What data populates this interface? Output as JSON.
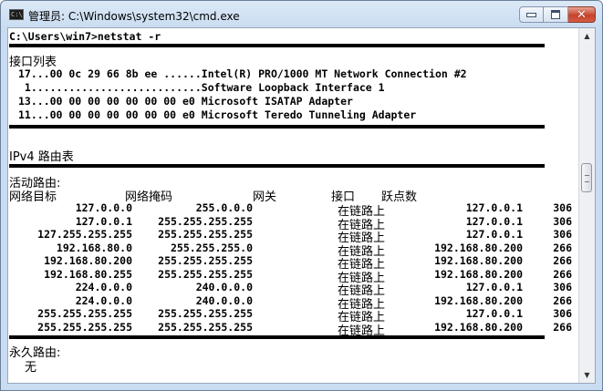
{
  "window": {
    "title": "管理员: C:\\Windows\\system32\\cmd.exe",
    "icon_text": "C:\\",
    "controls": [
      "minimize-icon",
      "maximize-icon",
      "close-icon"
    ]
  },
  "console": {
    "prompt": "C:\\Users\\win7>netstat -r",
    "interface_list_header": "接口列表",
    "interfaces": [
      "17...00 0c 29 66 8b ee ......Intel(R) PRO/1000 MT Network Connection #2",
      " 1...........................Software Loopback Interface 1",
      "13...00 00 00 00 00 00 00 e0 Microsoft ISATAP Adapter",
      "11...00 00 00 00 00 00 00 e0 Microsoft Teredo Tunneling Adapter"
    ],
    "ipv4_title": "IPv4 路由表",
    "active_routes_label": "活动路由:",
    "columns": [
      "网络目标",
      "网络掩码",
      "网关",
      "接口",
      "跃点数"
    ],
    "routes": [
      {
        "dest": "127.0.0.0",
        "mask": "255.0.0.0",
        "gateway": "在链路上",
        "iface": "127.0.0.1",
        "metric": "306"
      },
      {
        "dest": "127.0.0.1",
        "mask": "255.255.255.255",
        "gateway": "在链路上",
        "iface": "127.0.0.1",
        "metric": "306"
      },
      {
        "dest": "127.255.255.255",
        "mask": "255.255.255.255",
        "gateway": "在链路上",
        "iface": "127.0.0.1",
        "metric": "306"
      },
      {
        "dest": "192.168.80.0",
        "mask": "255.255.255.0",
        "gateway": "在链路上",
        "iface": "192.168.80.200",
        "metric": "266"
      },
      {
        "dest": "192.168.80.200",
        "mask": "255.255.255.255",
        "gateway": "在链路上",
        "iface": "192.168.80.200",
        "metric": "266"
      },
      {
        "dest": "192.168.80.255",
        "mask": "255.255.255.255",
        "gateway": "在链路上",
        "iface": "192.168.80.200",
        "metric": "266"
      },
      {
        "dest": "224.0.0.0",
        "mask": "240.0.0.0",
        "gateway": "在链路上",
        "iface": "127.0.0.1",
        "metric": "306"
      },
      {
        "dest": "224.0.0.0",
        "mask": "240.0.0.0",
        "gateway": "在链路上",
        "iface": "192.168.80.200",
        "metric": "266"
      },
      {
        "dest": "255.255.255.255",
        "mask": "255.255.255.255",
        "gateway": "在链路上",
        "iface": "127.0.0.1",
        "metric": "306"
      },
      {
        "dest": "255.255.255.255",
        "mask": "255.255.255.255",
        "gateway": "在链路上",
        "iface": "192.168.80.200",
        "metric": "266"
      }
    ],
    "persistent_routes_label": "永久路由:",
    "persistent_none": "无"
  }
}
